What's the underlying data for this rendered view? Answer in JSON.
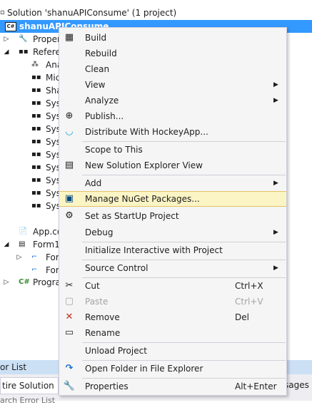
{
  "tree": {
    "solution_label": "Solution 'shanuAPIConsume' (1 project)",
    "project_label": "shanuAPIConsume",
    "properties_label": "Proper",
    "references_label": "Referen",
    "reference_items": [
      "Ana",
      "Mic",
      "Sha",
      "Sys",
      "Sys",
      "Sys",
      "Sys",
      "Sys",
      "Sys",
      "Sys",
      "Sys",
      "Sys"
    ],
    "app_config_label": "App.co",
    "form1_label": "Form1",
    "form1_children": [
      "For",
      "For"
    ],
    "program_label": "Progra",
    "csharp_badge": "C#"
  },
  "bottom_panel": {
    "tab_label": "or List",
    "filter_label": "tire Solution",
    "column_header": "sages",
    "search_label": "arch Error List"
  },
  "context_menu": {
    "items": [
      {
        "label": "Build",
        "icon": "build-icon",
        "glyph": "▦"
      },
      {
        "label": "Rebuild",
        "icon": "",
        "glyph": ""
      },
      {
        "label": "Clean",
        "icon": "",
        "glyph": ""
      },
      {
        "label": "View",
        "icon": "",
        "glyph": "",
        "submenu": "▶"
      },
      {
        "label": "Analyze",
        "icon": "",
        "glyph": "",
        "submenu": "▶"
      },
      {
        "label": "Publish...",
        "icon": "publish-icon",
        "glyph": "⊕"
      },
      {
        "label": "Distribute With HockeyApp...",
        "icon": "hockeyapp-icon",
        "glyph": "◡"
      },
      {
        "label": "Scope to This",
        "icon": "",
        "glyph": ""
      },
      {
        "label": "New Solution Explorer View",
        "icon": "new-view-icon",
        "glyph": "▤"
      },
      {
        "label": "Add",
        "icon": "",
        "glyph": "",
        "submenu": "▶"
      },
      {
        "label": "Manage NuGet Packages...",
        "icon": "nuget-icon",
        "glyph": "▣"
      },
      {
        "label": "Set as StartUp Project",
        "icon": "startup-gear-icon",
        "glyph": "⚙"
      },
      {
        "label": "Debug",
        "icon": "",
        "glyph": "",
        "submenu": "▶"
      },
      {
        "label": "Initialize Interactive with Project",
        "icon": "",
        "glyph": ""
      },
      {
        "label": "Source Control",
        "icon": "",
        "glyph": "",
        "submenu": "▶"
      },
      {
        "label": "Cut",
        "icon": "cut-icon",
        "glyph": "✂",
        "shortcut": "Ctrl+X"
      },
      {
        "label": "Paste",
        "icon": "paste-icon",
        "glyph": "▢",
        "shortcut": "Ctrl+V"
      },
      {
        "label": "Remove",
        "icon": "remove-icon",
        "glyph": "✕",
        "shortcut": "Del"
      },
      {
        "label": "Rename",
        "icon": "rename-icon",
        "glyph": "▭"
      },
      {
        "label": "Unload Project",
        "icon": "",
        "glyph": ""
      },
      {
        "label": "Open Folder in File Explorer",
        "icon": "open-folder-icon",
        "glyph": "↷"
      },
      {
        "label": "Properties",
        "icon": "wrench-icon",
        "glyph": "🔧",
        "shortcut": "Alt+Enter"
      }
    ]
  },
  "colors": {
    "selection": "#3399ff",
    "menu_bg": "#f5f5f5",
    "highlight_bg": "#fbf4c4",
    "highlight_border": "#e5c365",
    "remove_red": "#c42b1c",
    "hockeyapp_blue": "#0a9bd8",
    "open_folder_blue": "#1a6fc9"
  }
}
